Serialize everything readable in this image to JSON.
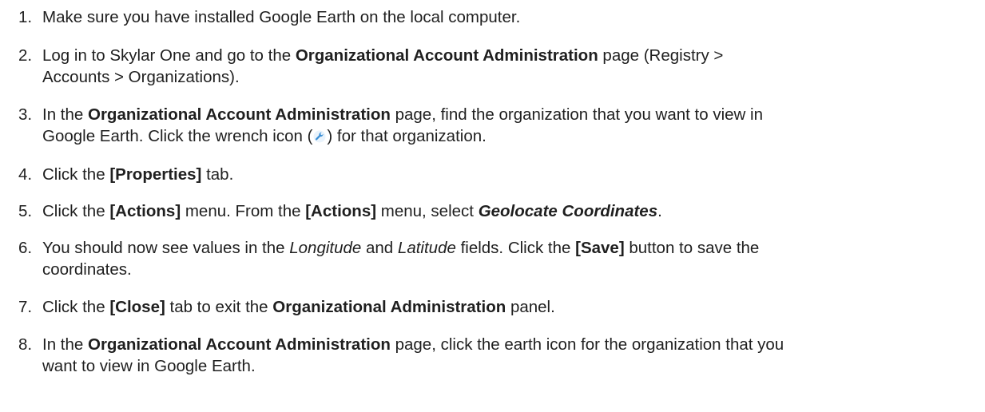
{
  "steps": [
    {
      "number": "1.",
      "parts": [
        "Make sure you have installed Google Earth on the local computer."
      ]
    },
    {
      "number": "2.",
      "parts": [
        "Log in to Skylar One and go to the ",
        "Organizational Account Administration",
        " page (Registry >",
        "Accounts > Organizations)."
      ]
    },
    {
      "number": "3.",
      "parts": [
        "In the ",
        "Organizational Account Administration",
        " page, find the organization that you want to view in",
        "Google Earth. Click the wrench icon (",
        ") for that organization."
      ]
    },
    {
      "number": "4.",
      "parts": [
        "Click the ",
        "[Properties]",
        " tab."
      ]
    },
    {
      "number": "5.",
      "parts": [
        "Click the ",
        "[Actions]",
        " menu. From the ",
        "[Actions]",
        " menu, select ",
        "Geolocate Coordinates",
        "."
      ]
    },
    {
      "number": "6.",
      "parts": [
        "You should now see values in the ",
        "Longitude",
        " and ",
        "Latitude",
        " fields. Click the ",
        "[Save]",
        " button to save the",
        "coordinates."
      ]
    },
    {
      "number": "7.",
      "parts": [
        "Click the ",
        "[Close]",
        " tab to exit the ",
        "Organizational Administration",
        " panel."
      ]
    },
    {
      "number": "8.",
      "parts": [
        "In the ",
        "Organizational Account Administration",
        " page, click the earth icon for the organization that you",
        "want to view in Google Earth."
      ]
    }
  ],
  "icons": {
    "wrench": "wrench-icon",
    "wrench_color": "#3a8fd6"
  }
}
